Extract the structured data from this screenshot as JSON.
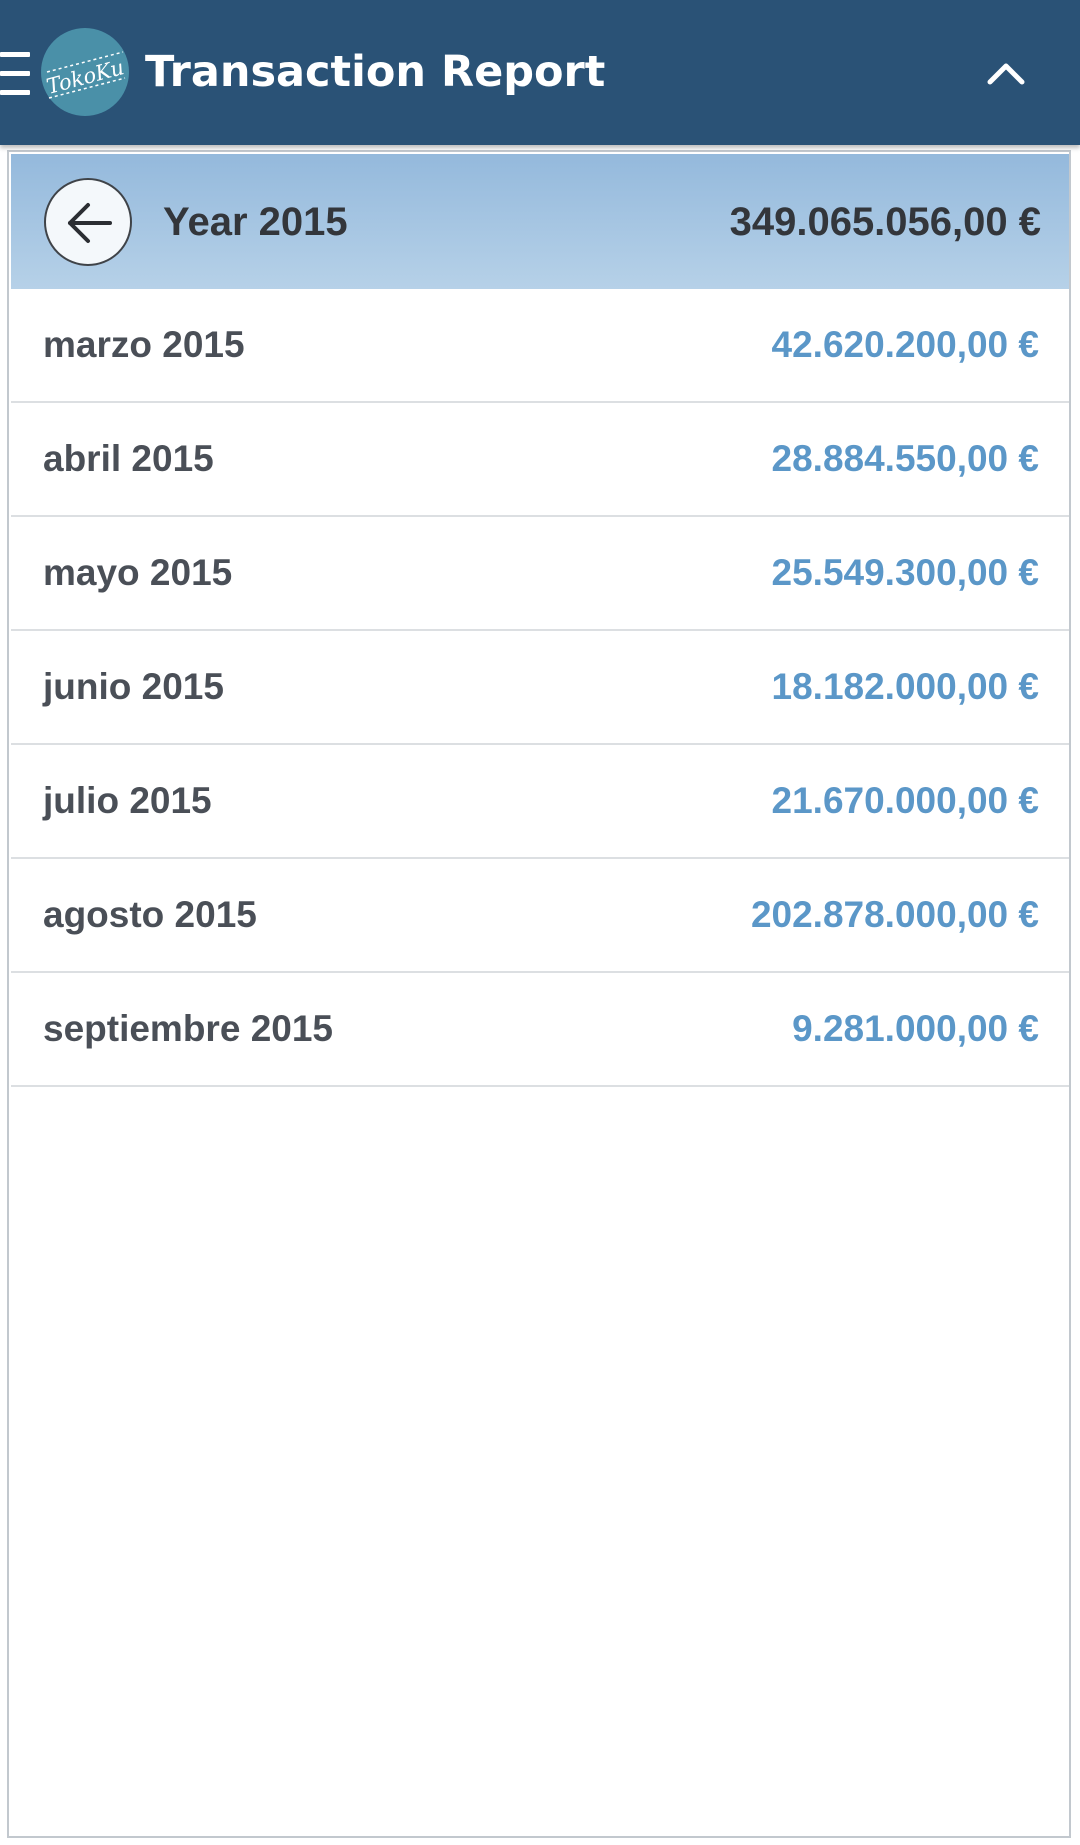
{
  "app": {
    "title": "Transaction Report",
    "logo_text": "TokoKu"
  },
  "colors": {
    "appbar": "#2a5276",
    "header_gradient_top": "#94b9dc",
    "header_gradient_bottom": "#b6d1e8",
    "amount": "#5b97c8",
    "text_dark": "#33363b",
    "logo": "#4a90a8"
  },
  "icons": {
    "menu": "hamburger-icon",
    "collapse": "chevron-up-icon",
    "back": "arrow-left-icon"
  },
  "year": {
    "label": "Year 2015",
    "total": "349.065.056,00 €"
  },
  "months": [
    {
      "label": "marzo 2015",
      "amount": "42.620.200,00 €"
    },
    {
      "label": "abril 2015",
      "amount": "28.884.550,00 €"
    },
    {
      "label": "mayo 2015",
      "amount": "25.549.300,00 €"
    },
    {
      "label": "junio 2015",
      "amount": "18.182.000,00 €"
    },
    {
      "label": "julio 2015",
      "amount": "21.670.000,00 €"
    },
    {
      "label": "agosto 2015",
      "amount": "202.878.000,00 €"
    },
    {
      "label": "septiembre 2015",
      "amount": "9.281.000,00 €"
    }
  ]
}
